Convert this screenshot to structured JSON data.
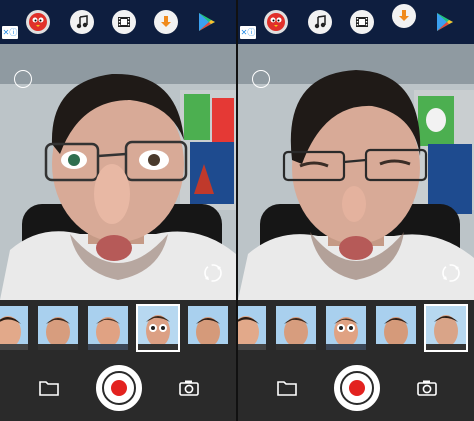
{
  "ad_bar": {
    "badge_icon": "ad-choices-icon",
    "icons": [
      "angry-bird-icon",
      "music-note-icon",
      "film-strip-icon",
      "download-arrow-icon",
      "play-store-icon"
    ],
    "colors": {
      "bg": "#0e1e3f"
    }
  },
  "panes": [
    {
      "selected_mask_index": 3
    },
    {
      "selected_mask_index": 4
    }
  ],
  "controls": {
    "left_icon": "folder-icon",
    "center_icon": "record-button",
    "right_icon": "camera-icon",
    "colors": {
      "record": "#e3221f"
    }
  }
}
